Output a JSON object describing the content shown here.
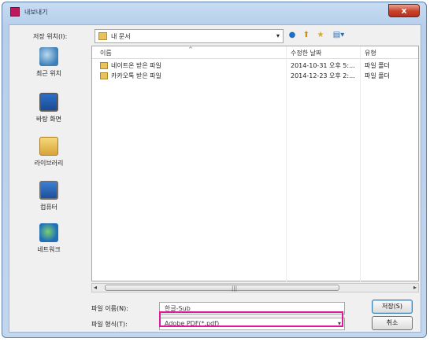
{
  "window": {
    "title": "내보내기",
    "close_label": "x"
  },
  "top": {
    "save_in_label": "저장 위치(I):",
    "folder": "내 문서",
    "dropdown_glyph": "▾",
    "icons": {
      "back": "●",
      "up": "⬆",
      "new_folder": "★",
      "view": "▤▾"
    }
  },
  "places": [
    {
      "label": "최근 위치",
      "icon": "recent-places-icon"
    },
    {
      "label": "바탕 화면",
      "icon": "desktop-icon"
    },
    {
      "label": "라이브러리",
      "icon": "libraries-icon"
    },
    {
      "label": "컴퓨터",
      "icon": "computer-icon"
    },
    {
      "label": "네트워크",
      "icon": "network-icon"
    }
  ],
  "columns": {
    "name": "이름",
    "date": "수정한 날짜",
    "type": "유형",
    "sort_glyph": "^"
  },
  "files": [
    {
      "name": "네이트온 받은 파일",
      "date": "2014-10-31 오후 5:...",
      "type": "파일 폴더"
    },
    {
      "name": "카카오톡 받은 파일",
      "date": "2014-12-23 오후 2:...",
      "type": "파일 폴더"
    }
  ],
  "scroll": {
    "left": "◂",
    "right": "▸",
    "grip": "|||"
  },
  "bottom": {
    "filename_label": "파일 이름(N):",
    "filename_value": "한글-Sub",
    "filetype_label": "파일 형식(T):",
    "filetype_value": "Adobe PDF(*.pdf)",
    "save_label": "저장(S)",
    "cancel_label": "취소"
  }
}
